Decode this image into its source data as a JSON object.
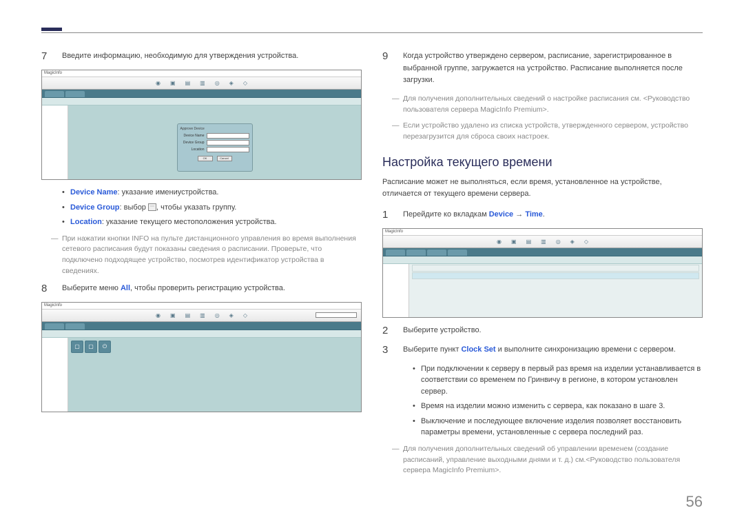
{
  "page_number": "56",
  "left": {
    "step7": {
      "num": "7",
      "text": "Введите информацию, необходимую для утверждения устройства."
    },
    "bullets": {
      "device_name_label": "Device Name",
      "device_name_text": ": указание имениустройства.",
      "device_group_label": "Device Group",
      "device_group_text_pre": ": выбор ",
      "device_group_text_post": ", чтобы указать группу.",
      "location_label": "Location",
      "location_text": ": указание текущего местоположения устройства."
    },
    "step7_note": "При нажатии кнопки INFO на пульте дистанционного управления во время выполнения сетевого расписания будут показаны сведения о расписании. Проверьте, что подключено подходящее устройство, посмотрев идентификатор устройства в сведениях.",
    "step8": {
      "num": "8",
      "text_pre": "Выберите меню ",
      "text_link": "All",
      "text_post": ", чтобы проверить регистрацию устройства."
    },
    "screenshot_common": {
      "brand": "MagicInfo",
      "dialog_title": "Approve Device",
      "dlg_row1": "Device Name",
      "dlg_row2": "Device Group",
      "dlg_row3": "Location",
      "ok": "OK",
      "cancel": "Cancel"
    }
  },
  "right": {
    "step9": {
      "num": "9",
      "text": "Когда устройство утверждено сервером, расписание, зарегистрированное в выбранной группе, загружается на устройство. Расписание выполняется после загрузки."
    },
    "note9a": "Для получения дополнительных сведений о настройке расписания см. <Руководство пользователя сервера MagicInfo Premium>.",
    "note9b": "Если устройство удалено из списка устройств, утвержденного сервером, устройство перезагрузится для сброса своих настроек.",
    "section_heading": "Настройка текущего времени",
    "section_intro": "Расписание может не выполняться, если время, установленное на устройстве, отличается от текущего времени сервера.",
    "step1": {
      "num": "1",
      "text_pre": "Перейдите ко вкладкам ",
      "link1": "Device",
      "arrow": " → ",
      "link2": "Time",
      "period": "."
    },
    "step2": {
      "num": "2",
      "text": "Выберите устройство."
    },
    "step3": {
      "num": "3",
      "text_pre": "Выберите пункт ",
      "link": "Clock Set",
      "text_post": " и выполните синхронизацию времени с сервером."
    },
    "sub_bullets": {
      "b1": "При подключении к серверу в первый раз время на изделии устанавливается в соответствии со временем по Гринвичу в регионе, в котором установлен сервер.",
      "b2": "Время на изделии можно изменить с сервера, как показано в шаге 3.",
      "b3": "Выключение и последующее включение изделия позволяет восстановить параметры времени, установленные с сервера последний раз."
    },
    "final_note": "Для получения дополнительных сведений об управлении временем (создание расписаний, управление выходными днями и т. д.) см.<Руководство пользователя сервера MagicInfo Premium>."
  }
}
